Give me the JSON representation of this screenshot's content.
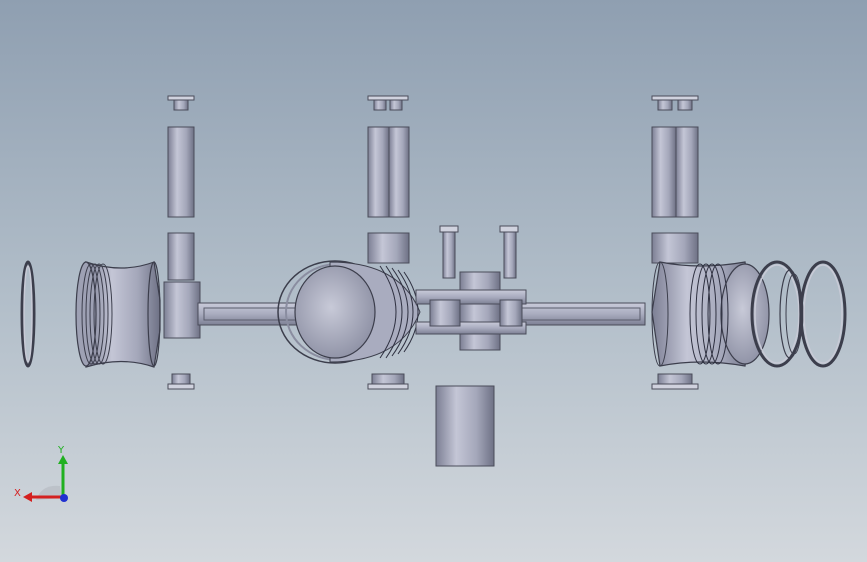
{
  "viewport": {
    "background_top": "#8f9fb1",
    "background_bottom": "#d3d8dd",
    "part_color": "#a7aabd",
    "part_shadow": "#6f7285",
    "part_highlight": "#d6d8e6"
  },
  "triad": {
    "x_label": "X",
    "y_label": "Y",
    "x_color": "#d42020",
    "y_color": "#20b020",
    "z_color": "#2030d0"
  }
}
